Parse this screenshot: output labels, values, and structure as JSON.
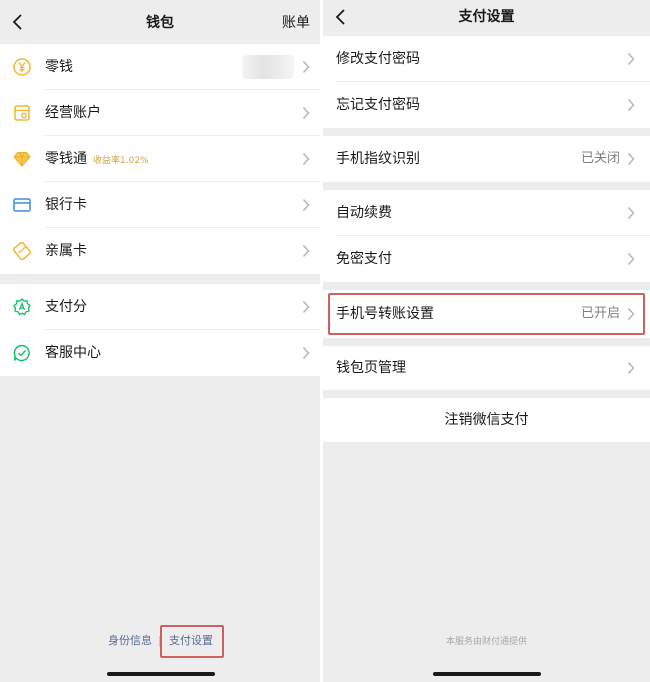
{
  "wallet": {
    "title": "钱包",
    "bill_link": "账单",
    "group1": [
      {
        "label": "零钱",
        "sub": "",
        "icon": "yuan-coin-icon"
      },
      {
        "label": "经营账户",
        "sub": "",
        "icon": "store-account-icon"
      },
      {
        "label": "零钱通",
        "sub": "收益率1.02%",
        "icon": "diamond-icon"
      },
      {
        "label": "银行卡",
        "sub": "",
        "icon": "bank-card-icon"
      },
      {
        "label": "亲属卡",
        "sub": "",
        "icon": "family-card-icon"
      }
    ],
    "group2": [
      {
        "label": "支付分",
        "icon": "pay-score-icon"
      },
      {
        "label": "客服中心",
        "icon": "customer-service-icon"
      }
    ],
    "footer": {
      "identity": "身份信息",
      "pay_settings": "支付设置"
    }
  },
  "settings": {
    "title": "支付设置",
    "group1": [
      {
        "label": "修改支付密码",
        "value": ""
      },
      {
        "label": "忘记支付密码",
        "value": ""
      }
    ],
    "fingerprint": {
      "label": "手机指纹识别",
      "value": "已关闭"
    },
    "group3": [
      {
        "label": "自动续费",
        "value": ""
      },
      {
        "label": "免密支付",
        "value": ""
      }
    ],
    "phone_transfer": {
      "label": "手机号转账设置",
      "value": "已开启"
    },
    "wallet_page": {
      "label": "钱包页管理",
      "value": ""
    },
    "cancel": "注销微信支付",
    "provided_by": "本服务由财付通提供"
  },
  "colors": {
    "accent_green": "#07c160",
    "icon_yellow": "#f2b532",
    "icon_blue": "#3e8fd9",
    "link_blue": "#576b95",
    "highlight_red": "#d0605f"
  }
}
